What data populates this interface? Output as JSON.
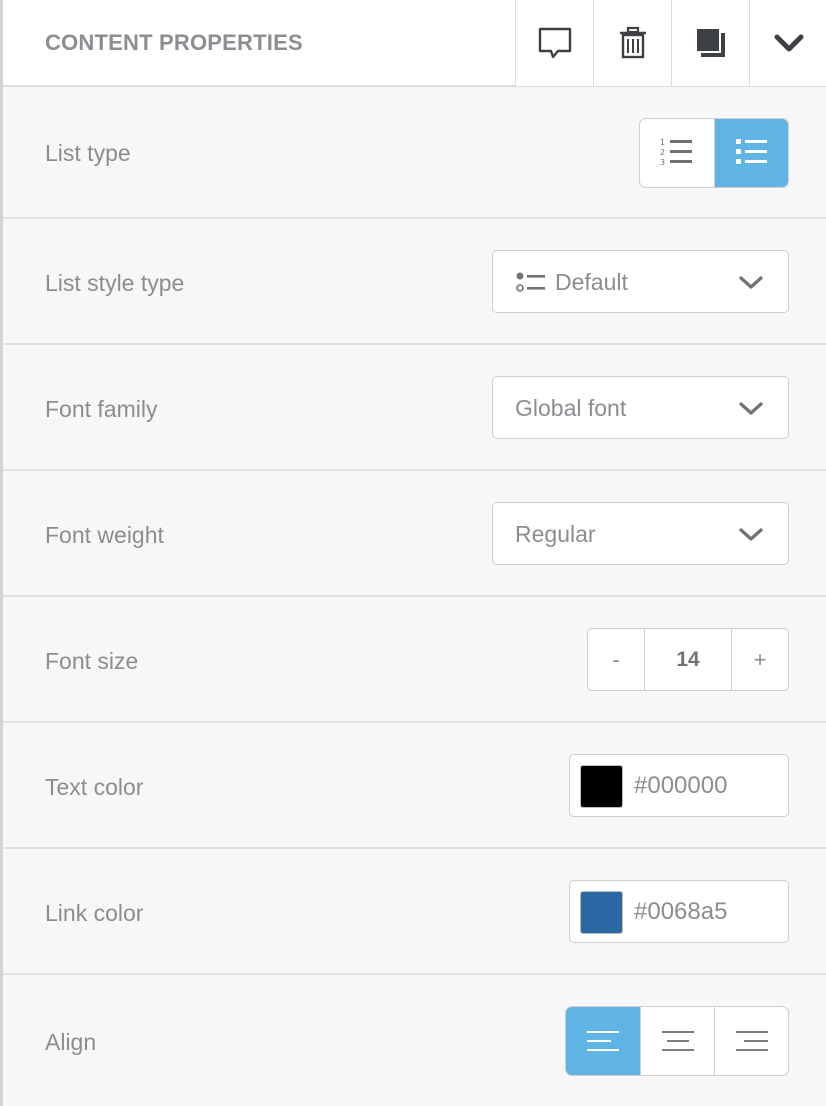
{
  "header": {
    "title": "CONTENT PROPERTIES",
    "actions": [
      {
        "name": "comment",
        "icon": "speech-bubble-icon"
      },
      {
        "name": "delete",
        "icon": "trash-icon"
      },
      {
        "name": "duplicate",
        "icon": "duplicate-icon"
      },
      {
        "name": "collapse",
        "icon": "chevron-down-icon"
      }
    ]
  },
  "rows": {
    "list_type": {
      "label": "List type",
      "options": [
        "ordered",
        "unordered"
      ],
      "selected": "unordered"
    },
    "list_style_type": {
      "label": "List style type",
      "value": "Default"
    },
    "font_family": {
      "label": "Font family",
      "value": "Global font"
    },
    "font_weight": {
      "label": "Font weight",
      "value": "Regular"
    },
    "font_size": {
      "label": "Font size",
      "minus": "-",
      "value": "14",
      "plus": "+"
    },
    "text_color": {
      "label": "Text color",
      "value": "#000000",
      "swatch": "#000000"
    },
    "link_color": {
      "label": "Link color",
      "value": "#0068a5",
      "swatch": "#2b67a1"
    },
    "align": {
      "label": "Align",
      "options": [
        "left",
        "center",
        "right"
      ],
      "selected": "left"
    }
  },
  "colors": {
    "accent": "#5fb4e4",
    "border": "#cdcdcd",
    "text": "#8a8d91",
    "background": "#f7f7f7"
  }
}
